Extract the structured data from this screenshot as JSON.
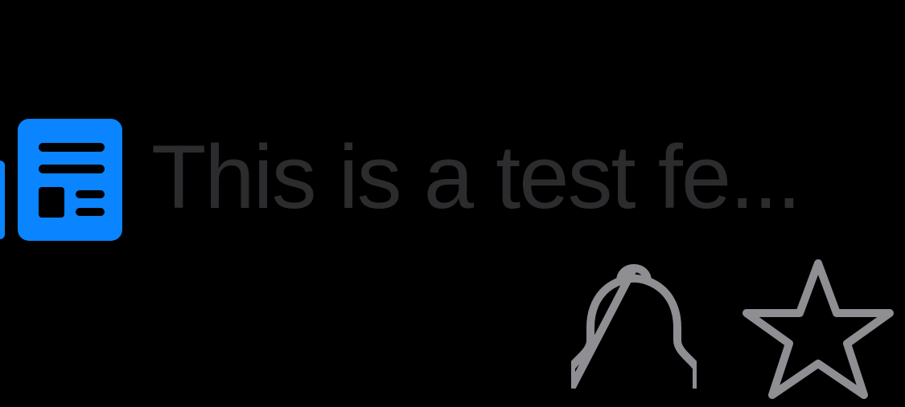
{
  "feed": {
    "title": "This is a test fe...",
    "icon": "newspaper-icon"
  },
  "actions": {
    "notify_icon": "bell-icon",
    "favorite_icon": "star-icon"
  },
  "colors": {
    "background": "#000000",
    "accent": "#0A84FF",
    "title_text": "#2C2C2E",
    "action_icon": "#8E8E93"
  }
}
